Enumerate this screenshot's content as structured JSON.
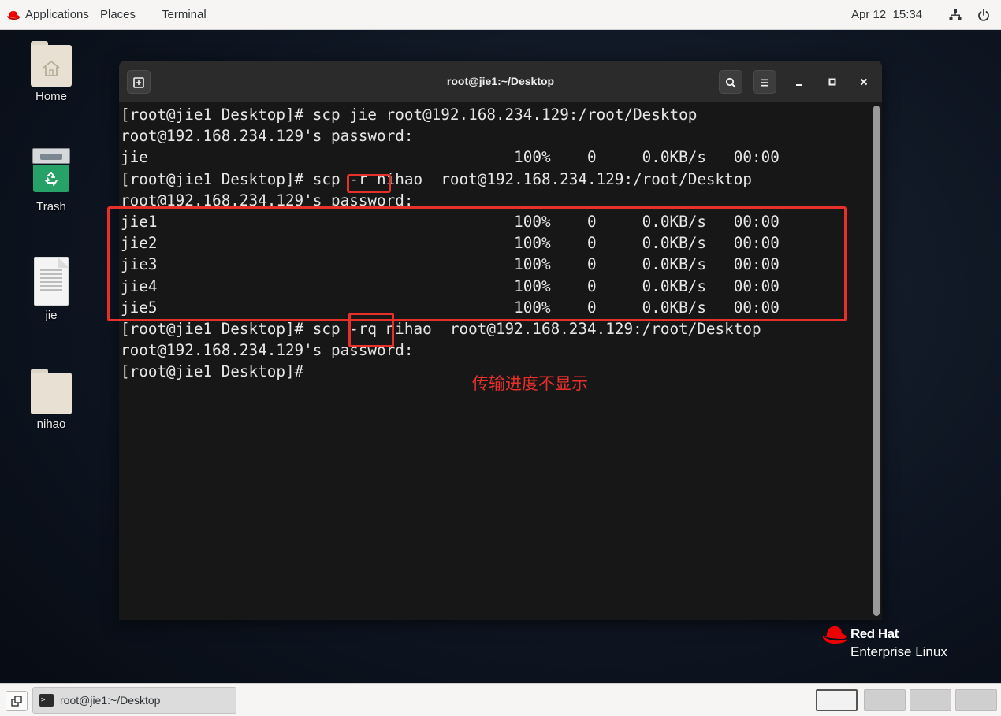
{
  "topbar": {
    "applications_label": "Applications",
    "places_label": "Places",
    "terminal_label": "Terminal",
    "clock": "Apr 12  15:34"
  },
  "desktop": {
    "icons": [
      {
        "label": "Home",
        "icon": "home-folder-icon"
      },
      {
        "label": "Trash",
        "icon": "trash-icon"
      },
      {
        "label": "jie",
        "icon": "text-file-icon"
      },
      {
        "label": "nihao",
        "icon": "folder-icon"
      }
    ]
  },
  "terminal": {
    "title": "root@jie1:~/Desktop",
    "lines": [
      "[root@jie1 Desktop]# scp jie root@192.168.234.129:/root/Desktop",
      "root@192.168.234.129's password:",
      "jie                                        100%    0     0.0KB/s   00:00",
      "[root@jie1 Desktop]# scp -r nihao  root@192.168.234.129:/root/Desktop",
      "root@192.168.234.129's password:",
      "jie1                                       100%    0     0.0KB/s   00:00",
      "jie2                                       100%    0     0.0KB/s   00:00",
      "jie3                                       100%    0     0.0KB/s   00:00",
      "jie4                                       100%    0     0.0KB/s   00:00",
      "jie5                                       100%    0     0.0KB/s   00:00",
      "[root@jie1 Desktop]# scp -rq nihao  root@192.168.234.129:/root/Desktop",
      "root@192.168.234.129's password:",
      "[root@jie1 Desktop]# "
    ],
    "annotation": "传输进度不显示"
  },
  "branding": {
    "line1": "Red Hat",
    "line2": "Enterprise Linux"
  },
  "taskbar": {
    "window_label": "root@jie1:~/Desktop",
    "workspaces": 4,
    "active_workspace": 1
  },
  "colors": {
    "annotation": "#e8302b",
    "redhat": "#ee0000",
    "terminal_bg": "#171717"
  }
}
